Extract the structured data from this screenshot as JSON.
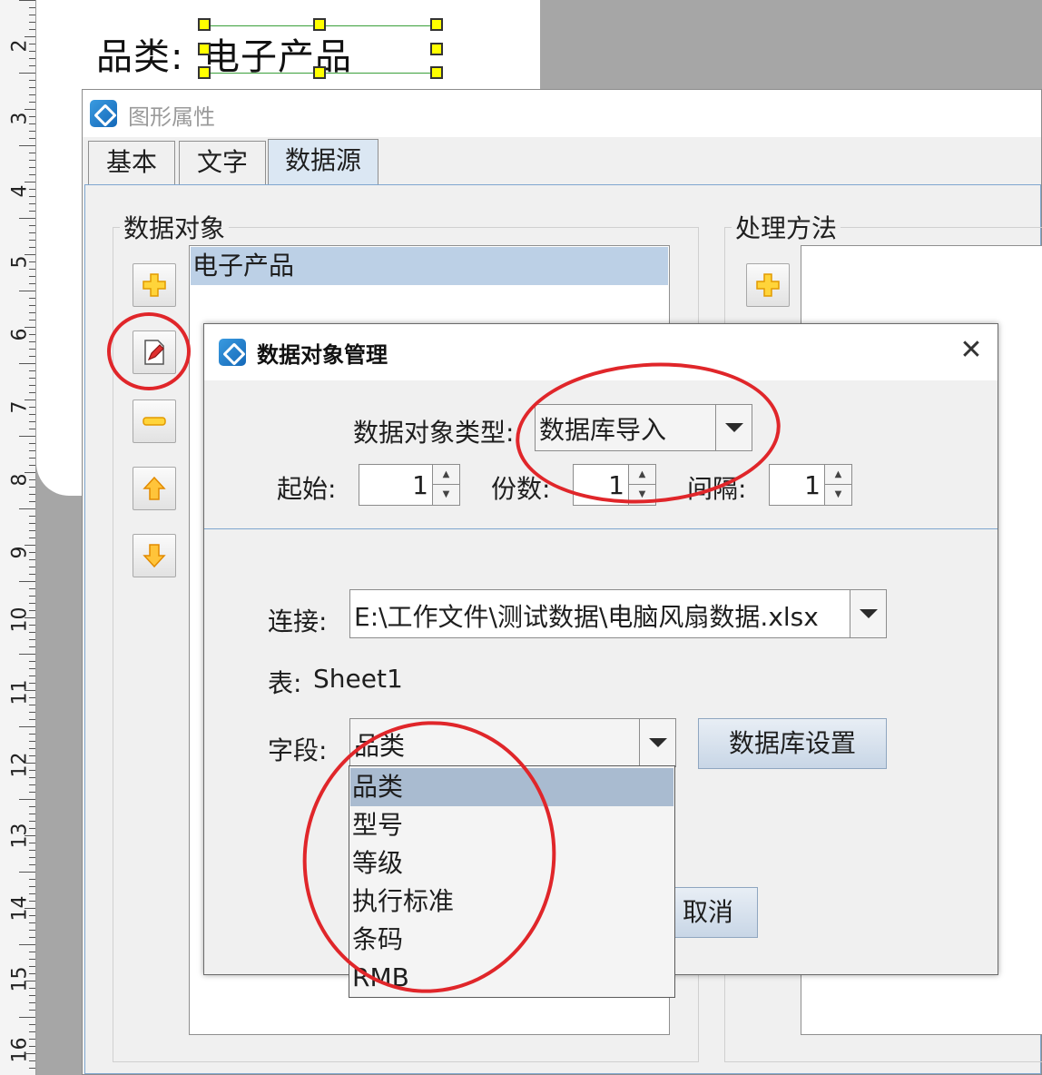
{
  "canvas": {
    "ruler_numbers": [
      "2",
      "3",
      "4",
      "5",
      "6",
      "7",
      "8",
      "9",
      "10",
      "11",
      "12",
      "13",
      "14",
      "15",
      "16"
    ],
    "label_text": "品类:",
    "value_text": "电子产品"
  },
  "properties_dialog": {
    "title": "图形属性",
    "tabs": [
      {
        "label": "基本"
      },
      {
        "label": "文字"
      },
      {
        "label": "数据源"
      }
    ],
    "data_object_group": {
      "label": "数据对象",
      "items": [
        "电子产品"
      ]
    },
    "processing_group": {
      "label": "处理方法"
    }
  },
  "data_object_manager": {
    "title": "数据对象管理",
    "close_glyph": "✕",
    "type_label": "数据对象类型:",
    "type_value": "数据库导入",
    "start_label": "起始:",
    "start_value": "1",
    "copies_label": "份数:",
    "copies_value": "1",
    "interval_label": "间隔:",
    "interval_value": "1",
    "connection_label": "连接:",
    "connection_value": "E:\\工作文件\\测试数据\\电脑风扇数据.xlsx",
    "table_label": "表:",
    "table_value": "Sheet1",
    "field_label": "字段:",
    "field_value": "品类",
    "db_settings_label": "数据库设置",
    "cancel_label": "取消",
    "field_options": [
      "品类",
      "型号",
      "等级",
      "执行标准",
      "条码",
      "RMB"
    ]
  },
  "colors": {
    "highlight_ring": "#e0262a",
    "selection_blue": "#bcd0e6",
    "tab_active": "#dbe7f3"
  },
  "icons": {
    "add": "plus-icon",
    "edit": "edit-pencil-icon",
    "remove": "minus-icon",
    "move_up": "arrow-up-icon",
    "move_down": "arrow-down-icon"
  }
}
